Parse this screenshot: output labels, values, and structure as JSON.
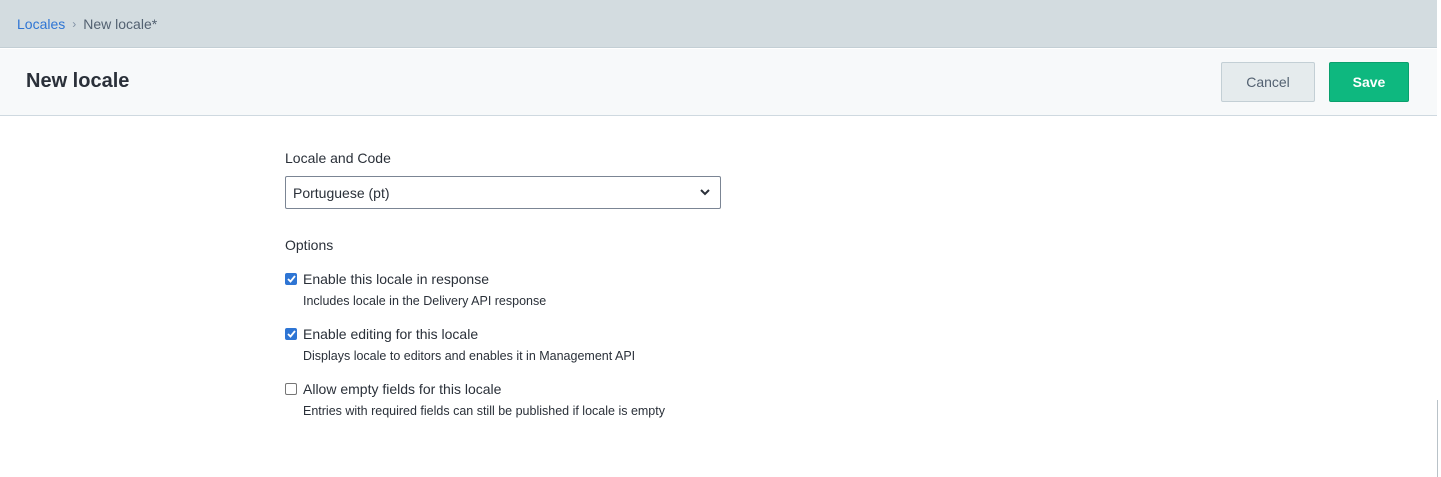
{
  "breadcrumb": {
    "parent": "Locales",
    "separator": "›",
    "current": "New locale*"
  },
  "header": {
    "title": "New locale",
    "cancel_label": "Cancel",
    "save_label": "Save"
  },
  "form": {
    "locale_label": "Locale and Code",
    "locale_value": "Portuguese (pt)",
    "options_label": "Options",
    "options": [
      {
        "title": "Enable this locale in response",
        "description": "Includes locale in the Delivery API response",
        "checked": true
      },
      {
        "title": "Enable editing for this locale",
        "description": "Displays locale to editors and enables it in Management API",
        "checked": true
      },
      {
        "title": "Allow empty fields for this locale",
        "description": "Entries with required fields can still be published if locale is empty",
        "checked": false
      }
    ]
  },
  "colors": {
    "accent": "#2e75d4",
    "save": "#0eb87f",
    "topbar": "#d3dce0"
  }
}
